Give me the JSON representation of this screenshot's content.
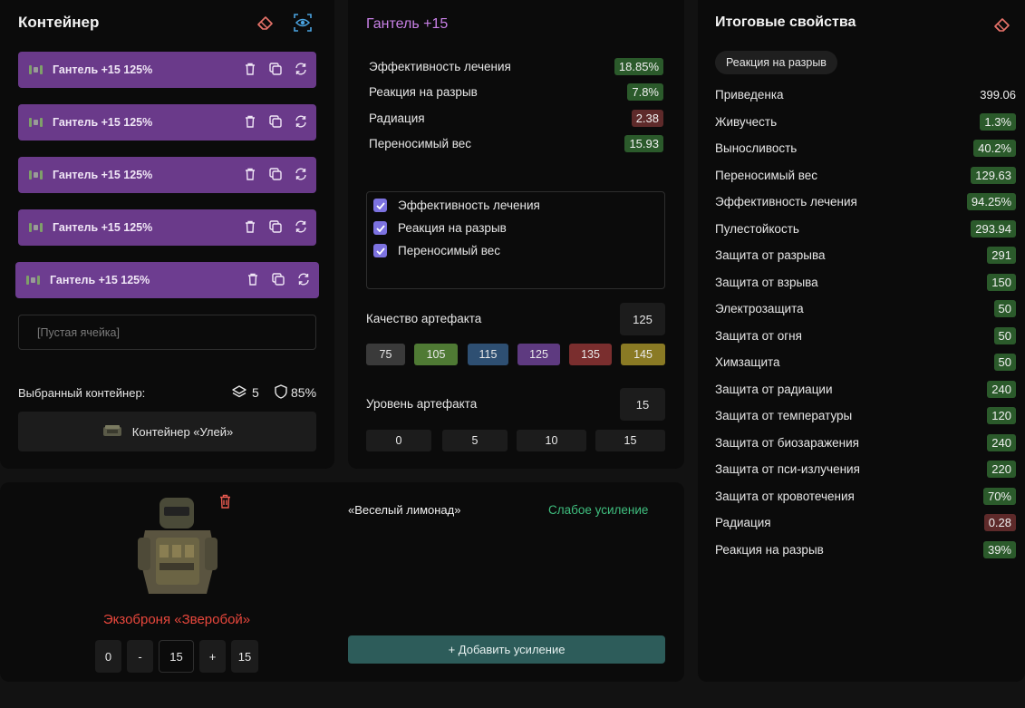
{
  "container_panel": {
    "title": "Контейнер",
    "slots": [
      {
        "label": "Гантель +15 125%"
      },
      {
        "label": "Гантель +15 125%"
      },
      {
        "label": "Гантель +15 125%"
      },
      {
        "label": "Гантель +15 125%"
      },
      {
        "label": "Гантель +15 125%"
      }
    ],
    "empty_slot_placeholder": "[Пустая ячейка]",
    "selected_label": "Выбранный контейнер:",
    "slots_count": "5",
    "protection": "85%",
    "container_name": "Контейнер «Улей»"
  },
  "artifact_panel": {
    "title": "Гантель +15",
    "stats": [
      {
        "name": "Эффективность лечения",
        "value": "18.85%",
        "tone": "green"
      },
      {
        "name": "Реакция на разрыв",
        "value": "7.8%",
        "tone": "green"
      },
      {
        "name": "Радиация",
        "value": "2.38",
        "tone": "red"
      },
      {
        "name": "Переносимый вес",
        "value": "15.93",
        "tone": "green"
      }
    ],
    "checkboxes": [
      {
        "label": "Эффективность лечения",
        "checked": true
      },
      {
        "label": "Реакция на разрыв",
        "checked": true
      },
      {
        "label": "Переносимый вес",
        "checked": true
      }
    ],
    "quality_label": "Качество артефакта",
    "quality_value": "125",
    "quality_options": [
      {
        "label": "75",
        "color": "#3a3a3a"
      },
      {
        "label": "105",
        "color": "#4f7a34"
      },
      {
        "label": "115",
        "color": "#2e4f72"
      },
      {
        "label": "125",
        "color": "#5e3a80"
      },
      {
        "label": "135",
        "color": "#7a2e2e"
      },
      {
        "label": "145",
        "color": "#8a7a24"
      }
    ],
    "level_label": "Уровень артефакта",
    "level_value": "15",
    "level_options": [
      "0",
      "5",
      "10",
      "15"
    ]
  },
  "armor_panel": {
    "name": "Экзоброня «Зверобой»",
    "stepper": {
      "min": "0",
      "minus": "-",
      "value": "15",
      "plus": "+",
      "max": "15"
    },
    "boost_name": "«Веселый лимонад»",
    "boost_level": "Слабое усиление",
    "add_boost_label": "+ Добавить усиление"
  },
  "totals_panel": {
    "title": "Итоговые свойства",
    "filter_chip": "Реакция на разрыв",
    "rows": [
      {
        "name": "Приведенка",
        "value": "399.06",
        "tone": "plain"
      },
      {
        "name": "Живучесть",
        "value": "1.3%",
        "tone": "green"
      },
      {
        "name": "Выносливость",
        "value": "40.2%",
        "tone": "green"
      },
      {
        "name": "Переносимый вес",
        "value": "129.63",
        "tone": "green"
      },
      {
        "name": "Эффективность лечения",
        "value": "94.25%",
        "tone": "green"
      },
      {
        "name": "Пулестойкость",
        "value": "293.94",
        "tone": "green"
      },
      {
        "name": "Защита от разрыва",
        "value": "291",
        "tone": "green"
      },
      {
        "name": "Защита от взрыва",
        "value": "150",
        "tone": "green"
      },
      {
        "name": "Электрозащита",
        "value": "50",
        "tone": "green"
      },
      {
        "name": "Защита от огня",
        "value": "50",
        "tone": "green"
      },
      {
        "name": "Химзащита",
        "value": "50",
        "tone": "green"
      },
      {
        "name": "Защита от радиации",
        "value": "240",
        "tone": "green"
      },
      {
        "name": "Защита от температуры",
        "value": "120",
        "tone": "green"
      },
      {
        "name": "Защита от биозаражения",
        "value": "240",
        "tone": "green"
      },
      {
        "name": "Защита от пси-излучения",
        "value": "220",
        "tone": "green"
      },
      {
        "name": "Защита от кровотечения",
        "value": "70%",
        "tone": "green"
      },
      {
        "name": "Радиация",
        "value": "0.28",
        "tone": "red"
      },
      {
        "name": "Реакция на разрыв",
        "value": "39%",
        "tone": "green"
      }
    ]
  }
}
